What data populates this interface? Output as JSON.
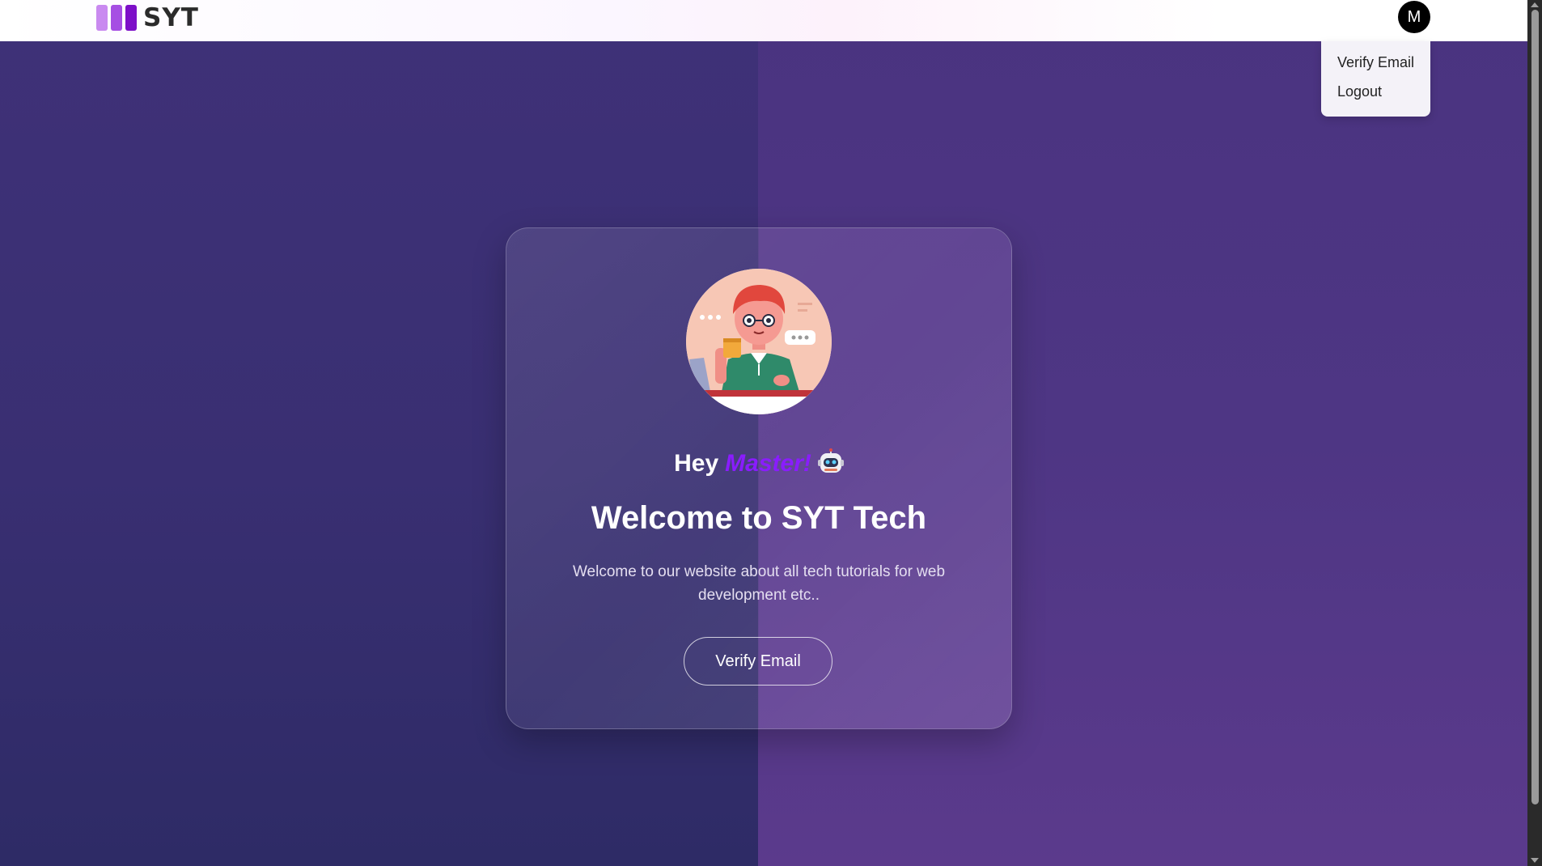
{
  "header": {
    "logo_text": "SYT",
    "avatar_initial": "M"
  },
  "user_menu": {
    "items": [
      {
        "label": "Verify Email"
      },
      {
        "label": "Logout"
      }
    ]
  },
  "card": {
    "greeting_prefix": "Hey",
    "greeting_name": "Master!",
    "title": "Welcome to SYT Tech",
    "description": "Welcome to our website about all tech tutorials for web development etc..",
    "button_label": "Verify Email"
  },
  "icons": {
    "greeting": "robot-icon",
    "illustration": "person-with-coffee-illustration"
  },
  "colors": {
    "accent": "#8a1cff",
    "bg_left": "#392f72",
    "bg_right": "#4e3684"
  }
}
